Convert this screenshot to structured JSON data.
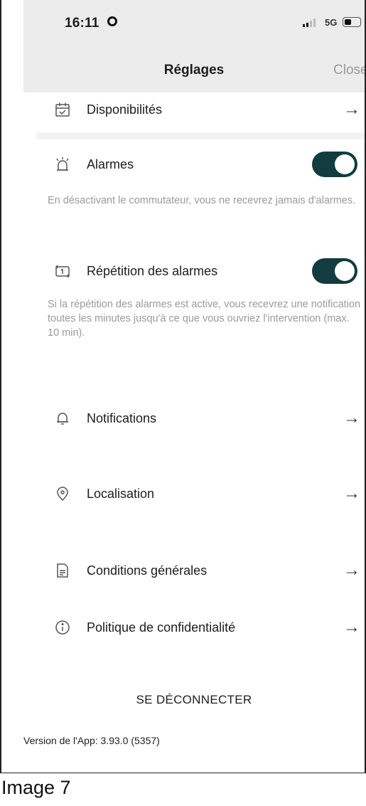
{
  "status_bar": {
    "time": "16:11",
    "network": "5G"
  },
  "nav": {
    "title": "Réglages",
    "close": "Close"
  },
  "rows": {
    "availability": {
      "label": "Disponibilités"
    },
    "alarms": {
      "label": "Alarmes",
      "enabled": true,
      "description": "En désactivant le commutateur, vous ne recevrez jamais d'alarmes."
    },
    "alarm_repeat": {
      "label": "Répétition des alarmes",
      "enabled": true,
      "description": "Si la répétition des alarmes est active, vous recevrez une notification toutes les minutes jusqu'à ce que vous ouvriez l'intervention (max. 10 min)."
    },
    "notifications": {
      "label": "Notifications"
    },
    "location": {
      "label": "Localisation"
    },
    "terms": {
      "label": "Conditions générales"
    },
    "privacy": {
      "label": "Politique de confidentialité"
    }
  },
  "logout_label": "SE DÉCONNECTER",
  "version_text": "Version de l'App: 3.93.0 (5357)",
  "caption": "Image 7",
  "colors": {
    "toggle_on": "#123c3f",
    "nav_background": "#ececec",
    "secondary_text": "#9a9a9a"
  }
}
